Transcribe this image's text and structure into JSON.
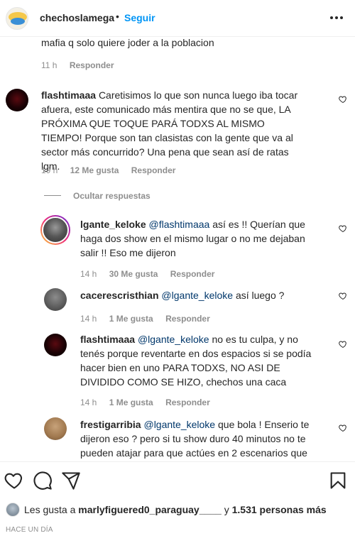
{
  "header": {
    "username": "chechoslamega",
    "separator": "•",
    "follow_label": "Seguir",
    "more_icon": "more-horizontal-icon"
  },
  "comments": {
    "partial": {
      "text": "mafia q solo quiere joder a la poblacion",
      "time": "11 h",
      "reply": "Responder"
    },
    "c1": {
      "username": "flashtimaaa",
      "text": "Caretisimos lo que son nunca luego iba tocar afuera, este comunicado más mentira que no se que, LA PRÓXIMA QUE TOQUE PARÁ TODXS AL MISMO TIEMPO! Porque son tan clasistas con la gente que va al sector más concurrido? Una pena que sean así de ratas lgm.",
      "time": "19 h",
      "likes": "12 Me gusta",
      "reply": "Responder",
      "hide_replies": "Ocultar respuestas"
    },
    "r1": {
      "username": "lgante_keloke",
      "mention": "@flashtimaaa",
      "text": "así es !! Querían que haga dos show en el mismo lugar o no me dejaban salir !! Eso me dijeron",
      "time": "14 h",
      "likes": "30 Me gusta",
      "reply": "Responder"
    },
    "r2": {
      "username": "cacerescristhian",
      "mention": "@lgante_keloke",
      "text": "así luego ?",
      "time": "14 h",
      "likes": "1 Me gusta",
      "reply": "Responder"
    },
    "r3": {
      "username": "flashtimaaa",
      "mention": "@lgante_keloke",
      "text": "no es tu culpa, y no tenés porque reventarte en dos espacios si se podía hacer bien en uno PARA TODXS, NO ASI DE DIVIDIDO COMO SE HIZO, chechos una caca",
      "time": "14 h",
      "likes": "1 Me gusta",
      "reply": "Responder"
    },
    "r4": {
      "username": "frestigarribia",
      "mention": "@lgante_keloke",
      "text": "que bola ! Enserio te dijeron eso ? pero si tu show duro 40 minutos no te pueden atajar para que actúes en 2 escenarios que"
    }
  },
  "actions": {
    "likes_prefix": "Les gusta a",
    "likes_user": "marlyfiguered0_paraguay____",
    "likes_mid": "y",
    "likes_count": "1.531 personas más",
    "posted": "HACE UN DÍA"
  }
}
